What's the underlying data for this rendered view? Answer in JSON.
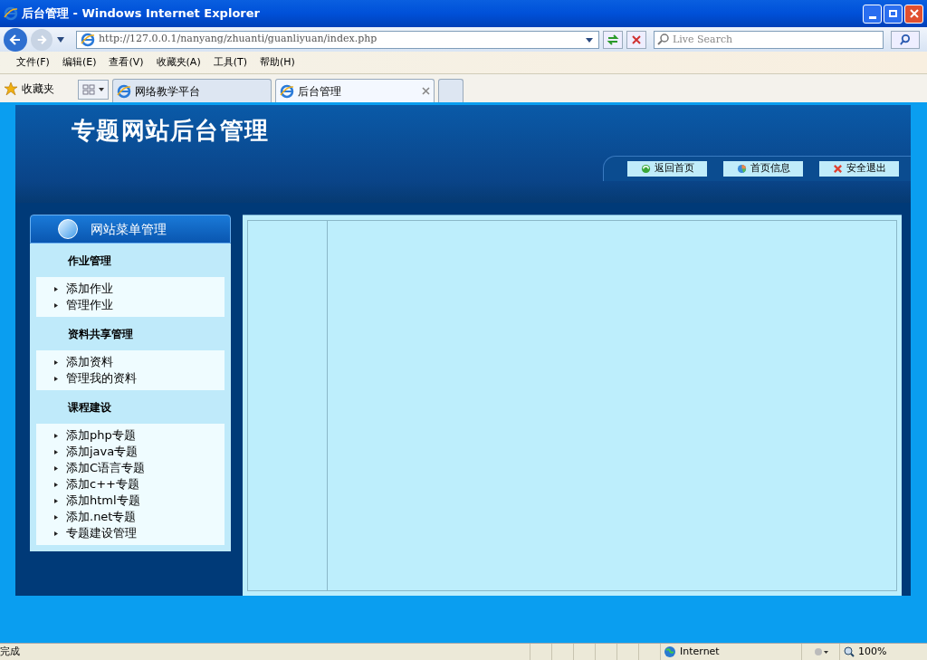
{
  "window": {
    "title": "后台管理 - Windows Internet Explorer"
  },
  "address_bar": {
    "url": "http://127.0.0.1/nanyang/zhuanti/guanliyuan/index.php"
  },
  "search": {
    "placeholder": "Live Search"
  },
  "menu_bar": [
    "文件(F)",
    "编辑(E)",
    "查看(V)",
    "收藏夹(A)",
    "工具(T)",
    "帮助(H)"
  ],
  "favorites": "收藏夹",
  "tabs": [
    {
      "label": "网络教学平台",
      "selected": false
    },
    {
      "label": "后台管理",
      "selected": true
    }
  ],
  "page": {
    "title": "专题网站后台管理",
    "header_buttons": [
      {
        "kind": "home",
        "label": "返回首页"
      },
      {
        "kind": "info",
        "label": "首页信息"
      },
      {
        "kind": "exit",
        "label": "安全退出"
      }
    ],
    "sidebar": {
      "title": "网站菜单管理",
      "groups": [
        {
          "title": "作业管理",
          "items": [
            "添加作业",
            "管理作业"
          ]
        },
        {
          "title": "资料共享管理",
          "items": [
            "添加资料",
            "管理我的资料"
          ]
        },
        {
          "title": "课程建设",
          "items": [
            "添加php专题",
            "添加java专题",
            "添加C语言专题",
            "添加c++专题",
            "添加html专题",
            "添加.net专题",
            "专题建设管理"
          ]
        }
      ]
    }
  },
  "status_bar": {
    "text": "完成",
    "zone": "Internet",
    "zoom": "100%"
  }
}
